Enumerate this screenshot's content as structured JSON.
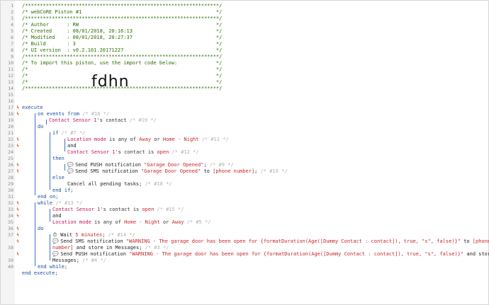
{
  "line_numbers": [
    "1",
    "2",
    "3",
    "4",
    "5",
    "6",
    "7",
    "8",
    "9",
    "10",
    "11",
    "12",
    "13",
    "14",
    "15",
    "16",
    "17",
    "18",
    "19",
    "20",
    "21",
    "22",
    "23",
    "24",
    "25",
    "26",
    "27",
    "28",
    "29",
    "30",
    "31",
    "32",
    "33",
    "34",
    "35",
    "36",
    "37",
    "",
    "38",
    "",
    "39",
    "40"
  ],
  "header": {
    "stars": "/*****************************************************************/",
    "title": "/* webCoRE Piston #1                                             */",
    "author": "/* Author      : RW                                              */",
    "created": "/* Created     : 08/01/2018, 20:16:13                            */",
    "modified": "/* Modified    : 08/01/2018, 20:27:37                            */",
    "build": "/* Build       : 3                                               */",
    "ui_version": "/* UI version  : v0.2.101.20171227                               */",
    "import_note": "/* To import this piston, use the import code below:             */",
    "empty_comment": "/*                                                               */",
    "import_code": "fdhn"
  },
  "code": {
    "execute": "execute",
    "on_events_from": "on events from",
    "c16": "/* #16 */",
    "contact_sensor": "Contact Sensor 1",
    "contact_attr": "'s contact",
    "c19": "/* #19 */",
    "do": "do",
    "if": "if",
    "c7": "/* #7 */",
    "location_mode": "Location mode",
    "is_any_of": "is any of",
    "away": "Away",
    "or": "or",
    "home_night": "Home - Night",
    "c11": "/* #11 */",
    "and": "and",
    "is_open_phrase": "is",
    "open": "open",
    "c12": "/* #12 */",
    "then": "then",
    "send_push": "Send PUSH notification",
    "garage_opened": "\"Garage Door Opened\"",
    "c9": "/* #9 */",
    "send_sms": "Send SMS notification",
    "to": "to",
    "phone_number": "[phone number]",
    "c10": "/* #10 */",
    "else": "else",
    "cancel_tasks": "Cancel all pending tasks;",
    "c18": "/* #18 */",
    "end_if": "end if;",
    "end_on": "end on;",
    "while": "while",
    "c13": "/* #13 */",
    "c15": "/* #15 */",
    "c5": "/* #5 */",
    "wait": "Wait",
    "wait_value": "5 minutes",
    "c14": "/* #14 */",
    "warning_str": "\"WARNING - The garage door has been open for {formatDuration(Age([Dummy Contact : contact]), true, \"s\", false)}\"",
    "phone_part1": "[phone",
    "phone_part2": "number]",
    "store_messages": "and store in Messages;",
    "c3": "/* #3 */",
    "store_in": "and store in",
    "messages": "Messages;",
    "c4": "/* #4 */",
    "end_while": "end while;",
    "end_execute": "end execute;"
  },
  "colors": {
    "comment": "#2a6e00",
    "keyword": "#1a4f9c",
    "device": "#c2185b",
    "value": "#c62828",
    "bracket": "#3c6fd0"
  },
  "icons": {
    "breakpoint": "breakpoint-icon",
    "push": "chat-bubble-icon",
    "timer": "clock-icon"
  }
}
